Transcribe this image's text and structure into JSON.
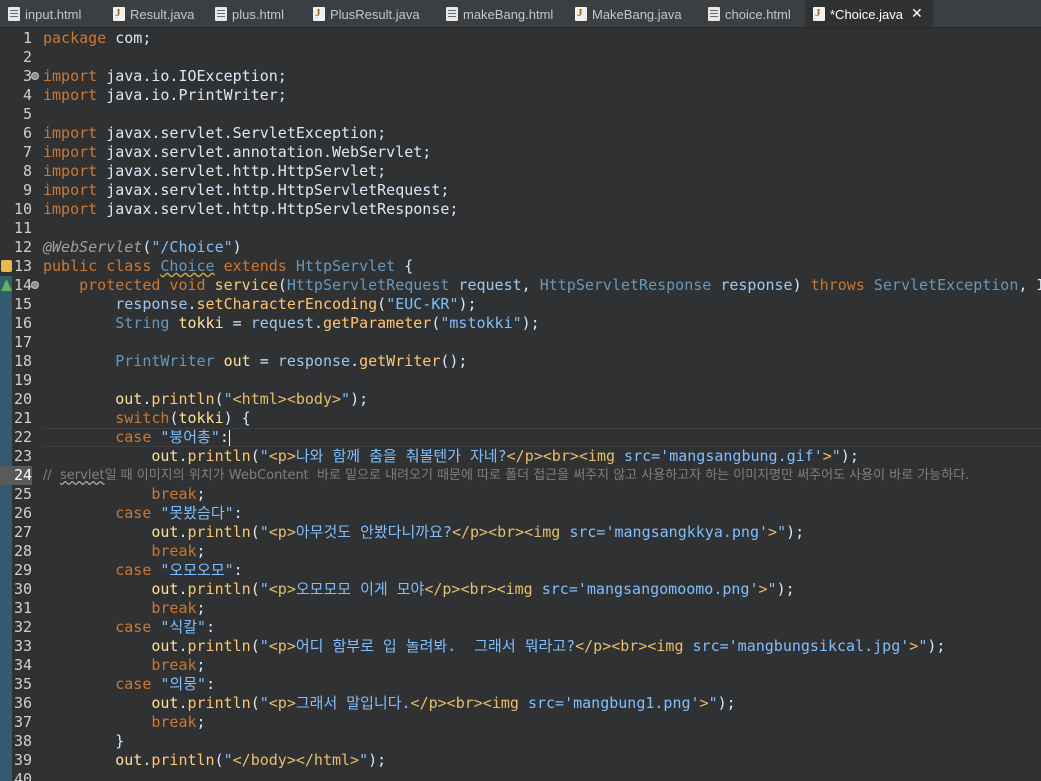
{
  "tabs": [
    {
      "label": "input.html",
      "kind": "html",
      "active": false
    },
    {
      "label": "Result.java",
      "kind": "java",
      "active": false
    },
    {
      "label": "plus.html",
      "kind": "html",
      "active": false
    },
    {
      "label": "PlusResult.java",
      "kind": "java",
      "active": false
    },
    {
      "label": "makeBang.html",
      "kind": "html",
      "active": false
    },
    {
      "label": "MakeBang.java",
      "kind": "java",
      "active": false
    },
    {
      "label": "choice.html",
      "kind": "html",
      "active": false
    },
    {
      "label": "*Choice.java",
      "kind": "java",
      "active": true
    }
  ],
  "tab_close_glyph": "✕",
  "highlighted_line": 24,
  "caret_line": 22,
  "lines": [
    [
      [
        "k",
        "package"
      ],
      [
        "p",
        " com;"
      ]
    ],
    [],
    [
      [
        "k",
        "import"
      ],
      [
        "p",
        " java.io.IOException;"
      ]
    ],
    [
      [
        "k",
        "import"
      ],
      [
        "p",
        " java.io.PrintWriter;"
      ]
    ],
    [],
    [
      [
        "k",
        "import"
      ],
      [
        "p",
        " javax.servlet.ServletException;"
      ]
    ],
    [
      [
        "k",
        "import"
      ],
      [
        "p",
        " javax.servlet.annotation.WebServlet;"
      ]
    ],
    [
      [
        "k",
        "import"
      ],
      [
        "p",
        " javax.servlet.http.HttpServlet;"
      ]
    ],
    [
      [
        "k",
        "import"
      ],
      [
        "p",
        " javax.servlet.http.HttpServletRequest;"
      ]
    ],
    [
      [
        "k",
        "import"
      ],
      [
        "p",
        " javax.servlet.http.HttpServletResponse;"
      ]
    ],
    [],
    [
      [
        "an",
        "@WebServlet"
      ],
      [
        "p",
        "("
      ],
      [
        "s",
        "\"/Choice\""
      ],
      [
        "p",
        ")"
      ]
    ],
    [
      [
        "k",
        "public class "
      ],
      [
        "tu",
        "Choice"
      ],
      [
        "k",
        " extends "
      ],
      [
        "t",
        "HttpServlet"
      ],
      [
        "p",
        " {"
      ]
    ],
    [
      [
        "p",
        "    "
      ],
      [
        "k",
        "protected void "
      ],
      [
        "m",
        "service"
      ],
      [
        "p",
        "("
      ],
      [
        "t",
        "HttpServletRequest"
      ],
      [
        "v",
        " request"
      ],
      [
        "p",
        ", "
      ],
      [
        "t",
        "HttpServletResponse"
      ],
      [
        "v",
        " response"
      ],
      [
        "p",
        ") "
      ],
      [
        "k",
        "throws "
      ],
      [
        "t",
        "ServletException"
      ],
      [
        "p",
        ", I"
      ]
    ],
    [
      [
        "p",
        "        "
      ],
      [
        "v",
        "response"
      ],
      [
        "p",
        "."
      ],
      [
        "m",
        "setCharacterEncoding"
      ],
      [
        "p",
        "("
      ],
      [
        "s",
        "\"EUC-KR\""
      ],
      [
        "p",
        ");"
      ]
    ],
    [
      [
        "p",
        "        "
      ],
      [
        "t",
        "String"
      ],
      [
        "l",
        " tokki"
      ],
      [
        "p",
        " = "
      ],
      [
        "v",
        "request"
      ],
      [
        "p",
        "."
      ],
      [
        "m",
        "getParameter"
      ],
      [
        "p",
        "("
      ],
      [
        "s",
        "\"mstokki\""
      ],
      [
        "p",
        ");"
      ]
    ],
    [],
    [
      [
        "p",
        "        "
      ],
      [
        "t",
        "PrintWriter"
      ],
      [
        "l",
        " out"
      ],
      [
        "p",
        " = "
      ],
      [
        "v",
        "response"
      ],
      [
        "p",
        "."
      ],
      [
        "m",
        "getWriter"
      ],
      [
        "p",
        "();"
      ]
    ],
    [],
    [
      [
        "p",
        "        "
      ],
      [
        "l",
        "out"
      ],
      [
        "p",
        "."
      ],
      [
        "m",
        "println"
      ],
      [
        "p",
        "("
      ],
      [
        "s",
        "\""
      ],
      [
        "g",
        "<html><body>"
      ],
      [
        "s",
        "\""
      ],
      [
        "p",
        ");"
      ]
    ],
    [
      [
        "p",
        "        "
      ],
      [
        "k",
        "switch"
      ],
      [
        "p",
        "("
      ],
      [
        "l",
        "tokki"
      ],
      [
        "p",
        ") {"
      ]
    ],
    [
      [
        "p",
        "        "
      ],
      [
        "k",
        "case "
      ],
      [
        "s",
        "\"붕어총\""
      ],
      [
        "p",
        ":"
      ]
    ],
    [
      [
        "p",
        "            "
      ],
      [
        "l",
        "out"
      ],
      [
        "p",
        "."
      ],
      [
        "m",
        "println"
      ],
      [
        "p",
        "("
      ],
      [
        "s",
        "\""
      ],
      [
        "g",
        "<p>"
      ],
      [
        "s",
        "나와 함께 춤을 춰볼텐가 자네?"
      ],
      [
        "g",
        "</p><br><img "
      ],
      [
        "s",
        "src='mangsangbung.gif'"
      ],
      [
        "g",
        ">"
      ],
      [
        "s",
        "\""
      ],
      [
        "p",
        ");"
      ]
    ],
    [
      [
        "c",
        "//  "
      ],
      [
        "cs",
        "servlet"
      ],
      [
        "c",
        "일 때 이미지의 위치가 WebContent  바로 밑으로 내려오기 때문에 따로 폴더 접근을 써주지 않고 사용하고자 하는 이미지명만 써주어도 사용이 바로 가능하다."
      ]
    ],
    [
      [
        "p",
        "            "
      ],
      [
        "k",
        "break"
      ],
      [
        "p",
        ";"
      ]
    ],
    [
      [
        "p",
        "        "
      ],
      [
        "k",
        "case "
      ],
      [
        "s",
        "\"못봤슴다\""
      ],
      [
        "p",
        ":"
      ]
    ],
    [
      [
        "p",
        "            "
      ],
      [
        "l",
        "out"
      ],
      [
        "p",
        "."
      ],
      [
        "m",
        "println"
      ],
      [
        "p",
        "("
      ],
      [
        "s",
        "\""
      ],
      [
        "g",
        "<p>"
      ],
      [
        "s",
        "아무것도 안봤다니까요?"
      ],
      [
        "g",
        "</p><br><img "
      ],
      [
        "s",
        "src='mangsangkkya.png'"
      ],
      [
        "g",
        ">"
      ],
      [
        "s",
        "\""
      ],
      [
        "p",
        ");"
      ]
    ],
    [
      [
        "p",
        "            "
      ],
      [
        "k",
        "break"
      ],
      [
        "p",
        ";"
      ]
    ],
    [
      [
        "p",
        "        "
      ],
      [
        "k",
        "case "
      ],
      [
        "s",
        "\"오모오모\""
      ],
      [
        "p",
        ":"
      ]
    ],
    [
      [
        "p",
        "            "
      ],
      [
        "l",
        "out"
      ],
      [
        "p",
        "."
      ],
      [
        "m",
        "println"
      ],
      [
        "p",
        "("
      ],
      [
        "s",
        "\""
      ],
      [
        "g",
        "<p>"
      ],
      [
        "s",
        "오모모모 이게 모야"
      ],
      [
        "g",
        "</p><br><img "
      ],
      [
        "s",
        "src='mangsangomoomo.png'"
      ],
      [
        "g",
        ">"
      ],
      [
        "s",
        "\""
      ],
      [
        "p",
        ");"
      ]
    ],
    [
      [
        "p",
        "            "
      ],
      [
        "k",
        "break"
      ],
      [
        "p",
        ";"
      ]
    ],
    [
      [
        "p",
        "        "
      ],
      [
        "k",
        "case "
      ],
      [
        "s",
        "\"식칼\""
      ],
      [
        "p",
        ":"
      ]
    ],
    [
      [
        "p",
        "            "
      ],
      [
        "l",
        "out"
      ],
      [
        "p",
        "."
      ],
      [
        "m",
        "println"
      ],
      [
        "p",
        "("
      ],
      [
        "s",
        "\""
      ],
      [
        "g",
        "<p>"
      ],
      [
        "s",
        "어디 함부로 입 놀려봐.  그래서 뭐라고?"
      ],
      [
        "g",
        "</p><br><img "
      ],
      [
        "s",
        "src='mangbungsikcal.jpg'"
      ],
      [
        "g",
        ">"
      ],
      [
        "s",
        "\""
      ],
      [
        "p",
        ");"
      ]
    ],
    [
      [
        "p",
        "            "
      ],
      [
        "k",
        "break"
      ],
      [
        "p",
        ";"
      ]
    ],
    [
      [
        "p",
        "        "
      ],
      [
        "k",
        "case "
      ],
      [
        "s",
        "\"의뭉\""
      ],
      [
        "p",
        ":"
      ]
    ],
    [
      [
        "p",
        "            "
      ],
      [
        "l",
        "out"
      ],
      [
        "p",
        "."
      ],
      [
        "m",
        "println"
      ],
      [
        "p",
        "("
      ],
      [
        "s",
        "\""
      ],
      [
        "g",
        "<p>"
      ],
      [
        "s",
        "그래서 말입니다."
      ],
      [
        "g",
        "</p><br><img "
      ],
      [
        "s",
        "src='mangbung1.png'"
      ],
      [
        "g",
        ">"
      ],
      [
        "s",
        "\""
      ],
      [
        "p",
        ");"
      ]
    ],
    [
      [
        "p",
        "            "
      ],
      [
        "k",
        "break"
      ],
      [
        "p",
        ";"
      ]
    ],
    [
      [
        "p",
        "        }"
      ]
    ],
    [
      [
        "p",
        "        "
      ],
      [
        "l",
        "out"
      ],
      [
        "p",
        "."
      ],
      [
        "m",
        "println"
      ],
      [
        "p",
        "("
      ],
      [
        "s",
        "\""
      ],
      [
        "g",
        "</body></html>"
      ],
      [
        "s",
        "\""
      ],
      [
        "p",
        ");"
      ]
    ],
    []
  ],
  "fold_lines": [
    3,
    14
  ],
  "marked_lines": [
    14,
    15,
    16,
    17,
    18,
    19,
    20,
    21,
    22,
    23,
    24,
    25,
    26,
    27,
    28,
    29,
    30,
    31,
    32,
    33,
    34,
    35,
    36,
    37,
    38,
    39,
    40
  ]
}
